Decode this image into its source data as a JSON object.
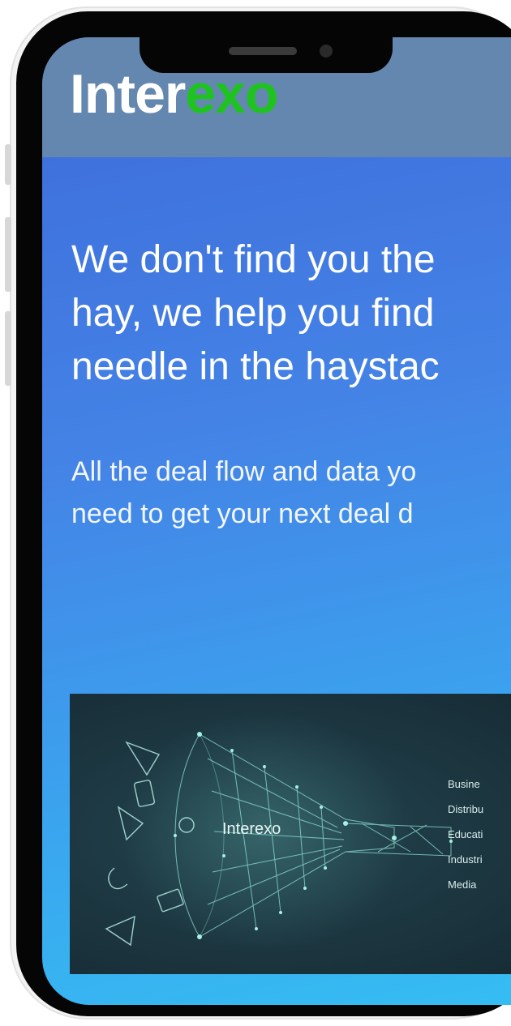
{
  "brand": {
    "part1": "Inter",
    "part2": "exo"
  },
  "hero": {
    "headline_lines": [
      "We don't find you the",
      "hay, we help you find",
      "needle in the haystac"
    ],
    "subline_lines": [
      "All the deal flow and data yo",
      "need to get your next deal d"
    ]
  },
  "panel": {
    "brand": "Interexo",
    "categories": [
      "Busine",
      "Distribu",
      "Educati",
      "Industri",
      "Media"
    ]
  },
  "colors": {
    "header": "#6487b0",
    "logo_accent": "#1fc31f",
    "panel": "#1c3640"
  }
}
